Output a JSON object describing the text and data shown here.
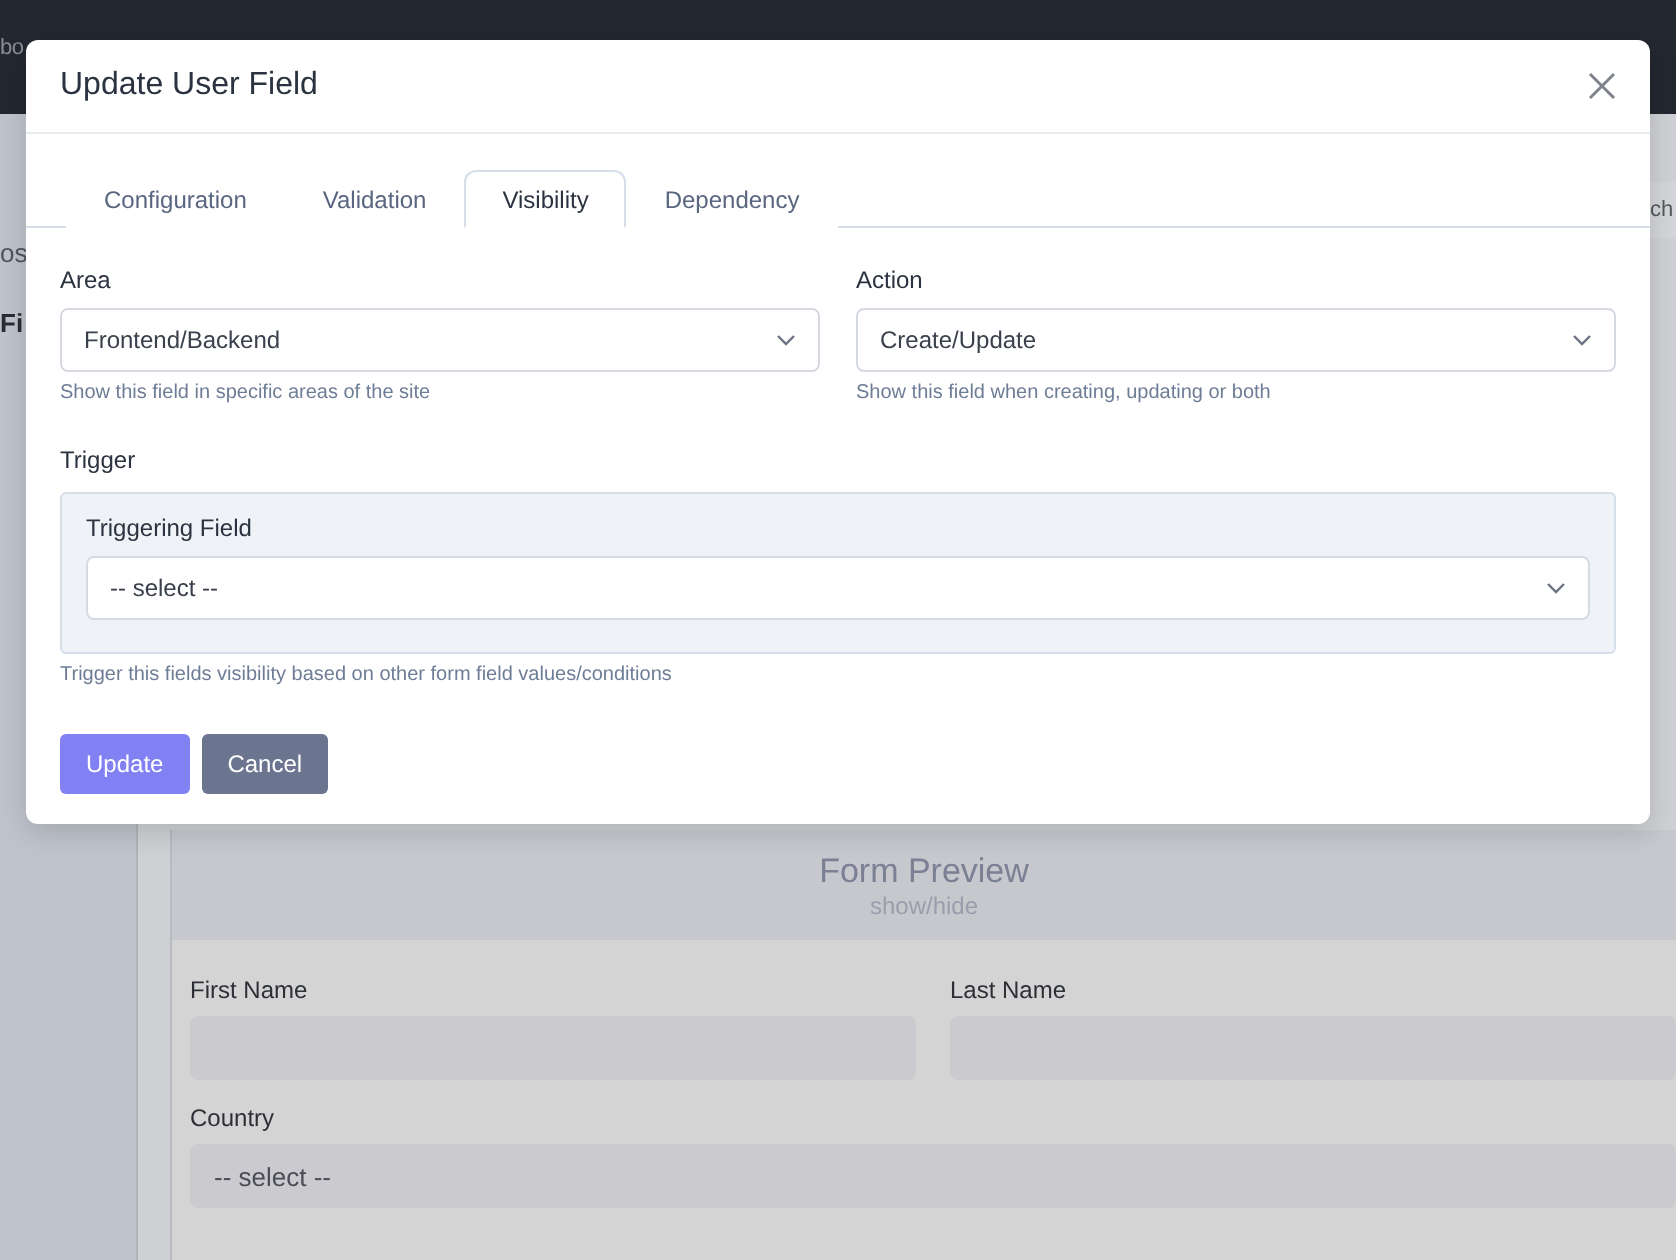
{
  "background": {
    "top_bar_text": "bo",
    "sidebar_items": [
      "os",
      "Fi"
    ],
    "search_text": "ch",
    "form_preview": {
      "title": "Form Preview",
      "toggle": "show/hide",
      "fields": [
        {
          "label": "First Name",
          "kind": "text"
        },
        {
          "label": "Last Name",
          "kind": "text"
        },
        {
          "label": "Country",
          "kind": "select",
          "value": "-- select --"
        }
      ]
    }
  },
  "dialog": {
    "title": "Update User Field",
    "tabs": [
      {
        "label": "Configuration",
        "selected": false
      },
      {
        "label": "Validation",
        "selected": false
      },
      {
        "label": "Visibility",
        "selected": true
      },
      {
        "label": "Dependency",
        "selected": false
      }
    ],
    "area": {
      "label": "Area",
      "value": "Frontend/Backend",
      "help": "Show this field in specific areas of the site"
    },
    "action": {
      "label": "Action",
      "value": "Create/Update",
      "help": "Show this field when creating, updating or both"
    },
    "trigger": {
      "heading": "Trigger",
      "field_label": "Triggering Field",
      "value": "-- select --",
      "help": "Trigger this fields visibility based on other form field values/conditions"
    },
    "buttons": [
      {
        "label": "Update",
        "kind": "primary"
      },
      {
        "label": "Cancel",
        "kind": "secondary"
      }
    ]
  }
}
